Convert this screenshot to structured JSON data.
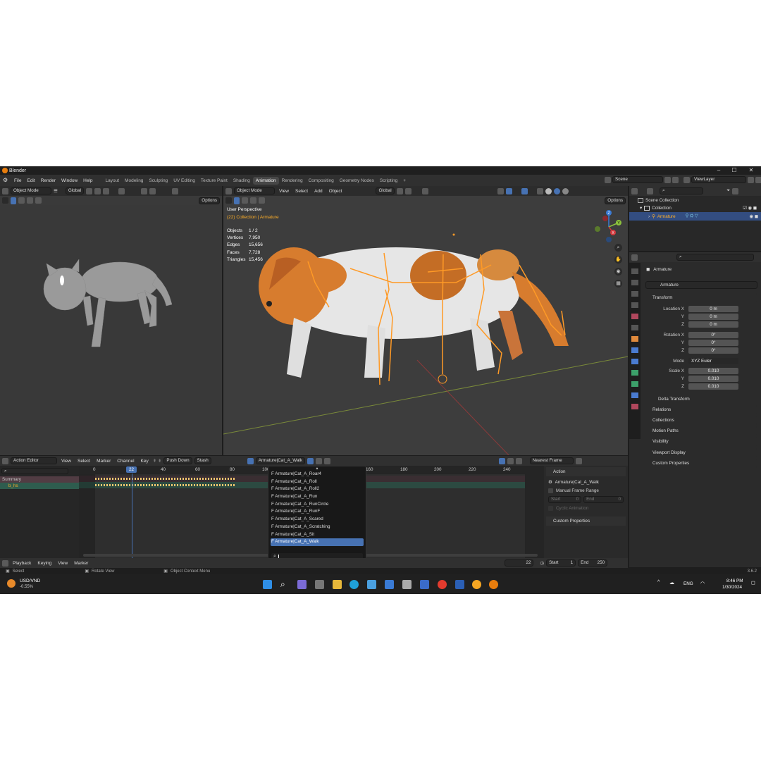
{
  "app": {
    "title": "Blender",
    "version": "3.6.2"
  },
  "menu": [
    "File",
    "Edit",
    "Render",
    "Window",
    "Help"
  ],
  "workspaces": [
    "Layout",
    "Modeling",
    "Sculpting",
    "UV Editing",
    "Texture Paint",
    "Shading",
    "Animation",
    "Rendering",
    "Compositing",
    "Geometry Nodes",
    "Scripting"
  ],
  "active_workspace": "Animation",
  "scene": {
    "name": "Scene",
    "view_layer": "ViewLayer"
  },
  "left_viewport": {
    "mode": "Object Mode",
    "orientation": "Global",
    "options": "Options"
  },
  "main_viewport": {
    "mode": "Object Mode",
    "menus": [
      "View",
      "Select",
      "Add",
      "Object"
    ],
    "orientation": "Global",
    "options": "Options",
    "perspective": "User Perspective",
    "collection_label": "(22) Collection | Armature",
    "stats": [
      {
        "label": "Objects",
        "value": "1 / 2"
      },
      {
        "label": "Vertices",
        "value": "7,950"
      },
      {
        "label": "Edges",
        "value": "15,656"
      },
      {
        "label": "Faces",
        "value": "7,728"
      },
      {
        "label": "Triangles",
        "value": "15,456"
      }
    ],
    "gizmo": {
      "z": "Z",
      "y": "Y",
      "x": "X"
    }
  },
  "outliner": {
    "scene_collection": "Scene Collection",
    "collection": "Collection",
    "armature": "Armature"
  },
  "properties": {
    "object_name": "Armature",
    "data_name": "Armature",
    "transform_label": "Transform",
    "location_label": "Location X",
    "rotation_label": "Rotation X",
    "scale_label": "Scale X",
    "y": "Y",
    "z": "Z",
    "location": [
      "0 m",
      "0 m",
      "0 m"
    ],
    "rotation": [
      "0°",
      "0°",
      "0°"
    ],
    "mode_label": "Mode",
    "mode_value": "XYZ Euler",
    "scale": [
      "0.010",
      "0.010",
      "0.010"
    ],
    "panels": [
      "Delta Transform",
      "Relations",
      "Collections",
      "Motion Paths",
      "Visibility",
      "Viewport Display",
      "Custom Properties"
    ]
  },
  "action_editor": {
    "editor": "Action Editor",
    "menus": [
      "View",
      "Select",
      "Marker",
      "Channel",
      "Key"
    ],
    "push_down": "Push Down",
    "stash": "Stash",
    "action_name": "Armature|Cat_A_Walk",
    "snap": "Nearest Frame",
    "ruler": [
      "0",
      "22",
      "40",
      "60",
      "80",
      "100",
      "120",
      "140",
      "160",
      "180",
      "200",
      "220",
      "240"
    ],
    "current_frame": "22",
    "channels": [
      "Summary",
      "b_hs"
    ],
    "sidebar": {
      "action_header": "Action",
      "action_name": "Armature|Cat_A_Walk",
      "manual_range": "Manual Frame Range",
      "start_label": "Start",
      "start_value": "0",
      "end_label": "End",
      "end_value": "0",
      "cyclic": "Cyclic Animation",
      "custom_props": "Custom Properties"
    }
  },
  "action_dropdown": {
    "items": [
      "F Armature|Cat_A_Roar4",
      "F Armature|Cat_A_Roll",
      "F Armature|Cat_A_Roll2",
      "F Armature|Cat_A_Run",
      "F Armature|Cat_A_RunCircle",
      "F Armature|Cat_A_RunF",
      "F Armature|Cat_A_Scared",
      "F Armature|Cat_A_Scratching",
      "F Armature|Cat_A_Sit",
      "F Armature|Cat_A_Walk"
    ],
    "selected_index": 9,
    "search_value": ""
  },
  "timeline": {
    "menus": [
      "Playback",
      "Keying",
      "View",
      "Marker"
    ],
    "frame": "22",
    "start_label": "Start",
    "start": "1",
    "end_label": "End",
    "end": "250"
  },
  "statusbar": {
    "select": "Select",
    "rotate": "Rotate View",
    "context": "Object Context Menu",
    "version": "3.6.2"
  },
  "taskbar": {
    "ticker": "USD/VND",
    "change": "-0.55%",
    "lang": "ENG",
    "time": "8:46 PM",
    "date": "1/30/2024"
  },
  "colors": {
    "accent": "#4772b3",
    "bone": "#ff9a26",
    "selected_text": "#ffaf29"
  }
}
